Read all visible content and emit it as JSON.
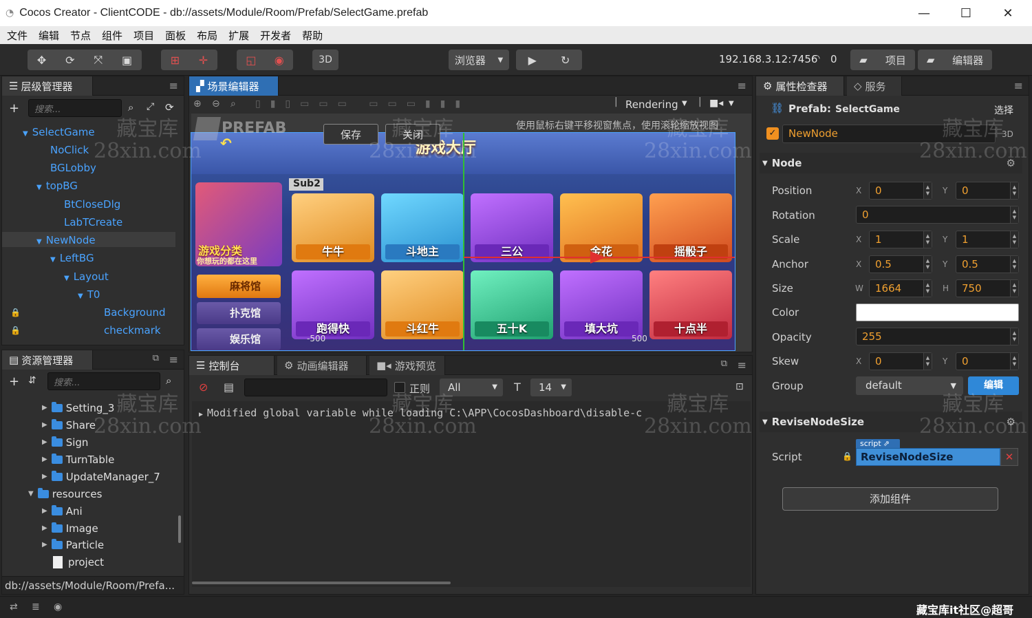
{
  "window": {
    "title": "Cocos Creator - ClientCODE - db://assets/Module/Room/Prefab/SelectGame.prefab",
    "minimize": "—",
    "maximize": "☐",
    "close": "✕"
  },
  "menu": [
    "文件",
    "编辑",
    "节点",
    "组件",
    "项目",
    "面板",
    "布局",
    "扩展",
    "开发者",
    "帮助"
  ],
  "toolbar": {
    "mode_3d": "3D",
    "browser": "浏览器",
    "ip": "192.168.3.12:7456",
    "device_count": "0",
    "project_btn": "项目",
    "editor_btn": "编辑器"
  },
  "hierarchy": {
    "tab": "层级管理器",
    "search_placeholder": "搜索...",
    "nodes": [
      "SelectGame",
      "NoClick",
      "BGLobby",
      "topBG",
      "BtCloseDlg",
      "LabTCreate",
      "NewNode",
      "LeftBG",
      "Layout",
      "T0",
      "Background",
      "checkmark"
    ]
  },
  "assets": {
    "tab": "资源管理器",
    "search_placeholder": "搜索...",
    "items": [
      "Setting_3",
      "Share",
      "Sign",
      "TurnTable",
      "UpdateManager_7",
      "resources",
      "Ani",
      "Image",
      "Particle",
      "project"
    ],
    "path": "db://assets/Module/Room/Prefa..."
  },
  "scene": {
    "tab": "场景编辑器",
    "rendering": "Rendering",
    "hint": "使用鼠标右键平移视窗焦点，使用滚轮缩放视图",
    "prefab_label": "PREFAB",
    "save": "保存",
    "close": "关闭",
    "hall_title": "游戏大厅",
    "sub_label": "Sub2",
    "left_banner_1": "游戏分类",
    "left_banner_2": "你想玩的都在这里",
    "left_menu": [
      "麻将馆",
      "扑克馆",
      "娱乐馆"
    ],
    "games_row1": [
      "牛牛",
      "斗地主",
      "三公",
      "金花",
      "摇骰子"
    ],
    "games_row2": [
      "跑得快",
      "斗红牛",
      "五十K",
      "填大坑",
      "十点半"
    ],
    "ruler_left": "-500",
    "ruler_right": "500",
    "colors": {
      "card1": "#f0a020",
      "card2": "#35b0e0",
      "card3": "#8a3fd0",
      "card4": "#f08a30",
      "card5": "#d84a30"
    }
  },
  "console": {
    "tabs": [
      "控制台",
      "动画编辑器",
      "游戏预览"
    ],
    "regex_label": "正则",
    "level": "All",
    "font_size": "14",
    "log": "Modified global variable while loading C:\\APP\\CocosDashboard\\disable-c"
  },
  "inspector": {
    "tabs": [
      "属性检查器",
      "服务"
    ],
    "prefab_label": "Prefab:",
    "prefab_name": "SelectGame",
    "select": "选择",
    "node_name": "NewNode",
    "badge_3d": "3D",
    "node_section": "Node",
    "props": {
      "position": {
        "label": "Position",
        "x": "0",
        "y": "0"
      },
      "rotation": {
        "label": "Rotation",
        "value": "0"
      },
      "scale": {
        "label": "Scale",
        "x": "1",
        "y": "1"
      },
      "anchor": {
        "label": "Anchor",
        "x": "0.5",
        "y": "0.5"
      },
      "size": {
        "label": "Size",
        "w": "1664",
        "h": "750"
      },
      "color": {
        "label": "Color",
        "value": "#ffffff"
      },
      "opacity": {
        "label": "Opacity",
        "value": "255"
      },
      "skew": {
        "label": "Skew",
        "x": "0",
        "y": "0"
      },
      "group": {
        "label": "Group",
        "value": "default",
        "edit": "编辑"
      }
    },
    "axis": {
      "x": "X",
      "y": "Y",
      "w": "W",
      "h": "H"
    },
    "component_section": "ReviseNodeSize",
    "script_label": "Script",
    "script_tag": "script",
    "script_value": "ReviseNodeSize",
    "add_component": "添加组件"
  },
  "watermark": {
    "line1": "藏宝库",
    "line2": "28xin.com",
    "corner": "藏宝库it社区@超哥"
  }
}
